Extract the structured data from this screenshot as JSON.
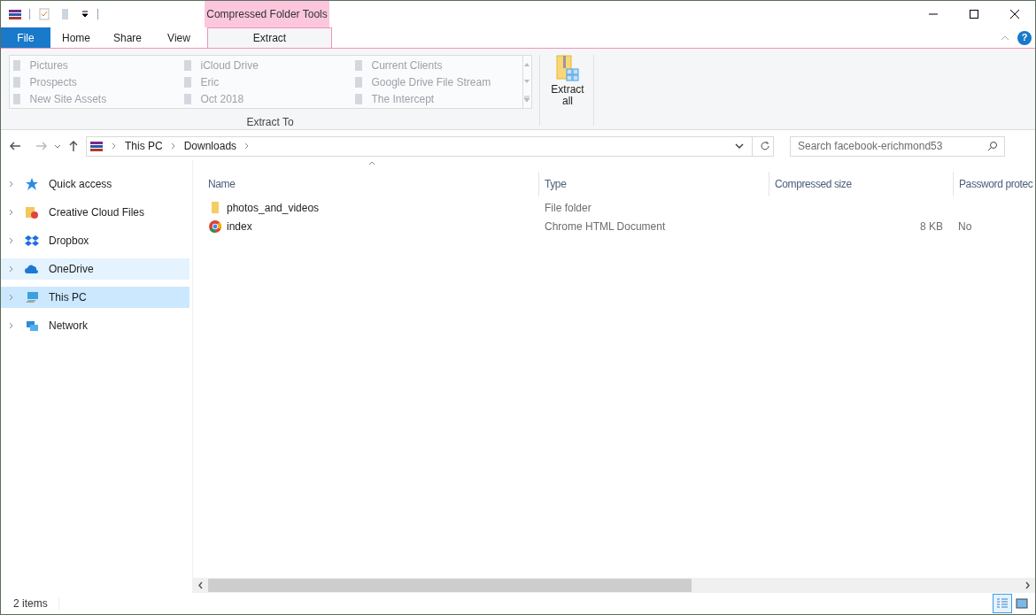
{
  "context_tab_group": "Compressed Folder Tools",
  "ribbon_tabs": [
    {
      "label": "File",
      "kind": "file",
      "selected": false
    },
    {
      "label": "Home",
      "kind": "tab",
      "selected": false
    },
    {
      "label": "Share",
      "kind": "tab",
      "selected": false
    },
    {
      "label": "View",
      "kind": "tab",
      "selected": false
    },
    {
      "label": "Extract",
      "kind": "context",
      "selected": true
    }
  ],
  "extract_to": {
    "label": "Extract To",
    "columns": [
      [
        {
          "label": "Pictures",
          "disabled": true
        },
        {
          "label": "Prospects",
          "disabled": true
        },
        {
          "label": "New Site Assets",
          "disabled": true
        }
      ],
      [
        {
          "label": "iCloud Drive",
          "disabled": true
        },
        {
          "label": "Eric",
          "disabled": true
        },
        {
          "label": "Oct 2018",
          "disabled": true
        }
      ],
      [
        {
          "label": "Current Clients",
          "disabled": true
        },
        {
          "label": "Google Drive File Stream",
          "disabled": true
        },
        {
          "label": "The Intercept",
          "disabled": true
        }
      ]
    ]
  },
  "help": {
    "label": "?"
  },
  "extract_all": {
    "label": "Extract\nall"
  },
  "address": {
    "crumbs": [
      "This PC",
      "Downloads"
    ]
  },
  "search": {
    "placeholder": "Search facebook-erichmond53"
  },
  "sidebar": {
    "items": [
      {
        "label": "Quick access",
        "kind": "star",
        "selected": false,
        "hovered": false
      },
      {
        "label": "Creative Cloud Files",
        "kind": "cc",
        "selected": false,
        "hovered": false
      },
      {
        "label": "Dropbox",
        "kind": "dropbox",
        "selected": false,
        "hovered": false
      },
      {
        "label": "OneDrive",
        "kind": "cloud",
        "selected": false,
        "hovered": true
      },
      {
        "label": "This PC",
        "kind": "pc",
        "selected": true,
        "hovered": false
      },
      {
        "label": "Network",
        "kind": "network",
        "selected": false,
        "hovered": false
      }
    ]
  },
  "table": {
    "columns": [
      "Name",
      "Type",
      "Compressed size",
      "Password protec"
    ],
    "rows": [
      {
        "kind": "folder",
        "cells": [
          "photos_and_videos",
          "File folder",
          "",
          ""
        ]
      },
      {
        "kind": "chrome",
        "cells": [
          "index",
          "Chrome HTML Document",
          "8 KB",
          "No"
        ]
      }
    ]
  },
  "status_bar": {
    "text": "2 items"
  },
  "views": [
    {
      "kind": "details",
      "selected": true
    },
    {
      "kind": "large",
      "selected": false
    }
  ]
}
